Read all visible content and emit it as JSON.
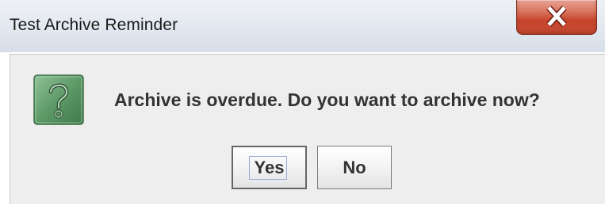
{
  "window": {
    "title": "Test Archive Reminder",
    "close_glyph": "X"
  },
  "dialog": {
    "icon": "question-icon",
    "message": "Archive is overdue.  Do you want to archive now?",
    "buttons": {
      "yes_label": "Yes",
      "no_label": "No"
    }
  },
  "colors": {
    "close_button": "#c7452c",
    "icon_green": "#5e9a68",
    "content_bg": "#eeeeee"
  }
}
